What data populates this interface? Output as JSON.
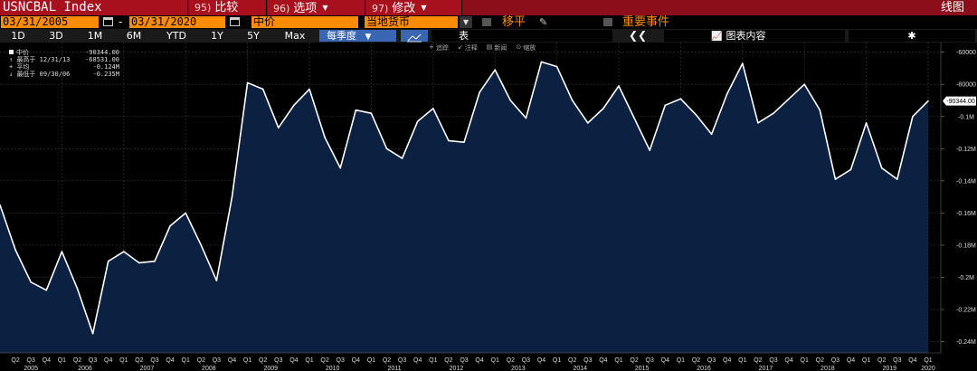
{
  "title_bar": {
    "ticker": "USNCBAL Index",
    "menu": [
      {
        "num": "95)",
        "label": "比较"
      },
      {
        "num": "96)",
        "label": "选项"
      },
      {
        "num": "97)",
        "label": "修改"
      }
    ],
    "right_label": "线图"
  },
  "params": {
    "start_date": "03/31/2005",
    "end_date": "03/31/2020",
    "price_field": "中价",
    "currency": "当地货币",
    "moving_avg_label": "移平",
    "events_label": "重要事件"
  },
  "periods": [
    "1D",
    "3D",
    "1M",
    "6M",
    "YTD",
    "1Y",
    "5Y",
    "Max"
  ],
  "frequency": "每季度",
  "table_label": "表",
  "chart_content_label": "图表内容",
  "tools": [
    "追踪",
    "注释",
    "新闻",
    "缩放"
  ],
  "legend": [
    {
      "label": "中价",
      "value": "-90344.00"
    },
    {
      "label": "最高于 12/31/13",
      "value": "-68531.00"
    },
    {
      "label": "平均",
      "value": "-0.124M"
    },
    {
      "label": "最低于 09/30/06",
      "value": "-0.235M"
    }
  ],
  "colors": {
    "title_bg": "#8b0e1a",
    "accent_orange": "#ff8c00",
    "button_blue": "#3a66b4",
    "area_fill": "#0c2142",
    "line": "#ffffff"
  },
  "chart_data": {
    "type": "area",
    "series": [
      {
        "name": "中价",
        "values": [
          -155000,
          -183000,
          -203000,
          -208000,
          -184000,
          -207000,
          -235000,
          -190000,
          -184000,
          -191000,
          -190000,
          -168000,
          -160000,
          -180000,
          -202000,
          -150000,
          -79000,
          -83000,
          -107000,
          -93000,
          -83000,
          -113000,
          -132000,
          -96000,
          -98000,
          -120000,
          -126000,
          -103000,
          -95000,
          -115000,
          -116000,
          -85000,
          -71000,
          -90000,
          -101000,
          -66000,
          -69000,
          -90000,
          -104000,
          -95000,
          -81000,
          -101000,
          -121000,
          -93000,
          -89000,
          -99000,
          -111000,
          -86000,
          -67000,
          -104000,
          -98000,
          -89000,
          -80000,
          -96000,
          -139000,
          -133000,
          -104000,
          -132000,
          -139000,
          -100000,
          -90344
        ]
      }
    ],
    "y_ticks": [
      "-60000",
      "-80000",
      "-0.1M",
      "-0.12M",
      "-0.14M",
      "-0.16M",
      "-0.18M",
      "-0.2M",
      "-0.22M",
      "-0.24M"
    ],
    "ylim": [
      -247000,
      -54000
    ],
    "last_value_label": "-90344.00",
    "x_quarter_labels": [
      "Q2",
      "Q3",
      "Q4",
      "Q1",
      "Q2",
      "Q3",
      "Q4",
      "Q1",
      "Q2",
      "Q3",
      "Q4",
      "Q1",
      "Q2",
      "Q3",
      "Q4",
      "Q1",
      "Q2",
      "Q3",
      "Q4",
      "Q1",
      "Q2",
      "Q3",
      "Q4",
      "Q1",
      "Q2",
      "Q3",
      "Q4",
      "Q1",
      "Q2",
      "Q3",
      "Q4",
      "Q1",
      "Q2",
      "Q3",
      "Q4",
      "Q1",
      "Q2",
      "Q3",
      "Q4",
      "Q1",
      "Q2",
      "Q3",
      "Q4",
      "Q1",
      "Q2",
      "Q3",
      "Q4",
      "Q1",
      "Q2",
      "Q3",
      "Q4",
      "Q1",
      "Q2",
      "Q3",
      "Q4",
      "Q1",
      "Q2",
      "Q3",
      "Q4",
      "Q1"
    ],
    "x_year_labels": [
      "2005",
      "2006",
      "2007",
      "2008",
      "2009",
      "2010",
      "2011",
      "2012",
      "2013",
      "2014",
      "2015",
      "2016",
      "2017",
      "2018",
      "2019",
      "2020"
    ],
    "grid": true
  }
}
